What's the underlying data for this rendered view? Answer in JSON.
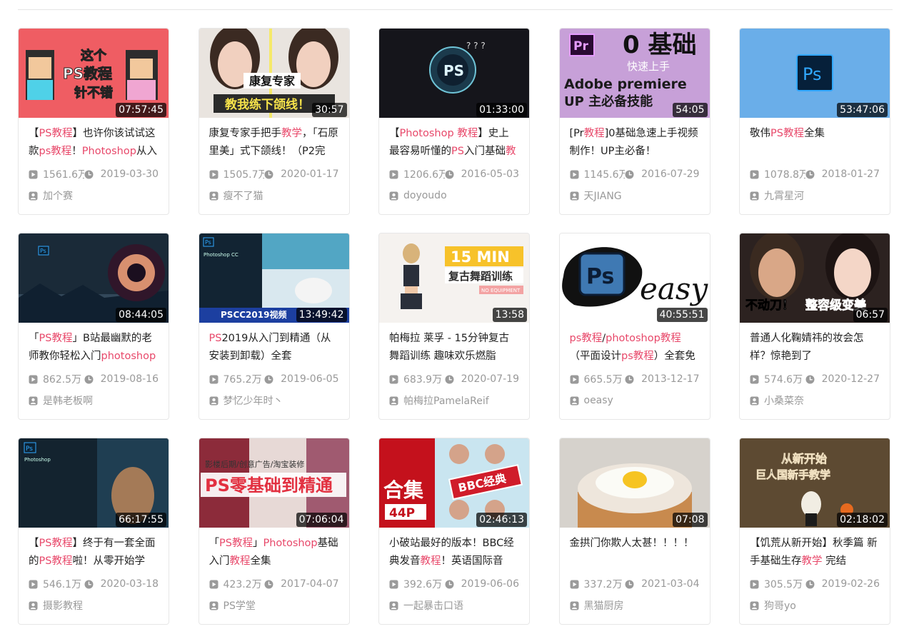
{
  "theme": {
    "highlight_color": "#e8486a",
    "duration_bg": "#000000",
    "meta_color": "#999999"
  },
  "icons": {
    "play": "play-icon",
    "clock": "clock-icon",
    "user": "user-icon"
  },
  "videos": [
    {
      "duration": "07:57:45",
      "title_segments": [
        {
          "t": "【",
          "h": false
        },
        {
          "t": "PS教程",
          "h": true
        },
        {
          "t": "】也许你该试试这款",
          "h": false
        },
        {
          "t": "ps教程",
          "h": true
        },
        {
          "t": "！",
          "h": false
        },
        {
          "t": "Photoshop",
          "h": true
        },
        {
          "t": "从入",
          "h": false
        }
      ],
      "views": "1561.6万",
      "date": "2019-03-30",
      "author": "加个赛",
      "thumb_caption": [
        "这个",
        "PS教程",
        "针不错"
      ]
    },
    {
      "duration": "30:57",
      "title_segments": [
        {
          "t": "康复专家手把手",
          "h": false
        },
        {
          "t": "教学",
          "h": true
        },
        {
          "t": "，「石原里美」式下颌线！（P2完",
          "h": false
        }
      ],
      "views": "1505.7万",
      "date": "2020-01-17",
      "author": "瘦不了猫",
      "thumb_caption": [
        "康复专家",
        "教我练下颌线！"
      ]
    },
    {
      "duration": "01:33:00",
      "title_segments": [
        {
          "t": "【",
          "h": false
        },
        {
          "t": "Photoshop 教程",
          "h": true
        },
        {
          "t": "】史上最容易听懂的",
          "h": false
        },
        {
          "t": "PS",
          "h": true
        },
        {
          "t": "入门基础",
          "h": false
        },
        {
          "t": "教程",
          "h": true
        }
      ],
      "views": "1206.6万",
      "date": "2016-05-03",
      "author": "doyoudo",
      "thumb_caption": [
        "PS"
      ]
    },
    {
      "duration": "54:05",
      "title_segments": [
        {
          "t": "[Pr",
          "h": false
        },
        {
          "t": "教程",
          "h": true
        },
        {
          "t": "]0基础急速上手视频制作！UP主必备！",
          "h": false
        }
      ],
      "views": "1145.6万",
      "date": "2016-07-29",
      "author": "天JIANG",
      "thumb_caption": [
        "0 基础",
        "快速上手",
        "Adobe premiere",
        "UP 主必备技能",
        "Pr"
      ]
    },
    {
      "duration": "53:47:06",
      "title_segments": [
        {
          "t": "敬伟",
          "h": false
        },
        {
          "t": "PS教程",
          "h": true
        },
        {
          "t": "全集",
          "h": false
        }
      ],
      "views": "1078.8万",
      "date": "2018-01-27",
      "author": "九霄星河",
      "thumb_caption": [
        "Ps"
      ]
    },
    {
      "duration": "08:44:05",
      "title_segments": [
        {
          "t": "「",
          "h": false
        },
        {
          "t": "PS教程",
          "h": true
        },
        {
          "t": "」B站最幽默的老师教你轻松入门",
          "h": false
        },
        {
          "t": "photoshop",
          "h": true
        }
      ],
      "views": "862.5万",
      "date": "2019-08-16",
      "author": "是韩老板啊",
      "thumb_caption": [
        "Ps"
      ]
    },
    {
      "duration": "13:49:42",
      "title_segments": [
        {
          "t": "PS",
          "h": true
        },
        {
          "t": "2019从入门到精通（从安装到卸载）全套",
          "h": false
        }
      ],
      "views": "765.2万",
      "date": "2019-06-05",
      "author": "梦忆少年时丶",
      "thumb_caption": [
        "Ps",
        "Photoshop CC",
        "PSCC2019视频"
      ]
    },
    {
      "duration": "13:58",
      "title_segments": [
        {
          "t": "帕梅拉 莱孚 - 15分钟复古舞蹈训练 趣味欢乐燃脂",
          "h": false
        }
      ],
      "views": "683.9万",
      "date": "2020-07-19",
      "author": "帕梅拉PamelaReif",
      "thumb_caption": [
        "15 MIN",
        "复古舞蹈训练",
        "NO EQUIPMENT"
      ]
    },
    {
      "duration": "40:55:51",
      "title_segments": [
        {
          "t": "ps教程",
          "h": true
        },
        {
          "t": "/",
          "h": false
        },
        {
          "t": "photoshop教程",
          "h": true
        },
        {
          "t": "（平面设计",
          "h": false
        },
        {
          "t": "ps教程",
          "h": true
        },
        {
          "t": "）全套免费",
          "h": false
        }
      ],
      "views": "665.5万",
      "date": "2013-12-17",
      "author": "oeasy",
      "thumb_caption": [
        "Ps",
        "easy"
      ]
    },
    {
      "duration": "06:57",
      "title_segments": [
        {
          "t": "普通人化鞠婧祎的妆会怎样？惊艳到了",
          "h": false
        }
      ],
      "views": "574.6万",
      "date": "2020-12-27",
      "author": "小桑菜奈",
      "thumb_caption": [
        "不动刀！",
        "整容级变美"
      ]
    },
    {
      "duration": "66:17:55",
      "title_segments": [
        {
          "t": "【",
          "h": false
        },
        {
          "t": "PS教程",
          "h": true
        },
        {
          "t": "】终于有一套全面的",
          "h": false
        },
        {
          "t": "PS教程",
          "h": true
        },
        {
          "t": "啦！从零开始学",
          "h": false
        }
      ],
      "views": "546.1万",
      "date": "2020-03-18",
      "author": "摄影教程",
      "thumb_caption": [
        "Ps",
        "Photoshop"
      ]
    },
    {
      "duration": "07:06:04",
      "title_segments": [
        {
          "t": "「",
          "h": false
        },
        {
          "t": "PS教程",
          "h": true
        },
        {
          "t": "」",
          "h": false
        },
        {
          "t": "Photoshop",
          "h": true
        },
        {
          "t": "基础入门",
          "h": false
        },
        {
          "t": "教程",
          "h": true
        },
        {
          "t": "全集",
          "h": false
        }
      ],
      "views": "423.2万",
      "date": "2017-04-07",
      "author": "PS学堂",
      "thumb_caption": [
        "影楼后期/创意广告/淘宝装修",
        "PS零基础到精通"
      ]
    },
    {
      "duration": "02:46:13",
      "title_segments": [
        {
          "t": "小破站最好的版本！BBC经典发音",
          "h": false
        },
        {
          "t": "教程",
          "h": true
        },
        {
          "t": "！英语国际音",
          "h": false
        }
      ],
      "views": "392.6万",
      "date": "2019-06-06",
      "author": "一起暴击口语",
      "thumb_caption": [
        "合集",
        "44P",
        "BBC经典"
      ]
    },
    {
      "duration": "07:08",
      "title_segments": [
        {
          "t": "金拱门你欺人太甚！！！！",
          "h": false
        }
      ],
      "views": "337.2万",
      "date": "2021-03-04",
      "author": "黑猫厨房",
      "thumb_caption": []
    },
    {
      "duration": "02:18:02",
      "title_segments": [
        {
          "t": "【饥荒从新开始】秋季篇 新手基础生存",
          "h": false
        },
        {
          "t": "教学",
          "h": true
        },
        {
          "t": " 完结",
          "h": false
        }
      ],
      "views": "305.5万",
      "date": "2019-02-26",
      "author": "狗哥yo",
      "thumb_caption": [
        "从新开始",
        "巨人国新手教学"
      ]
    }
  ]
}
